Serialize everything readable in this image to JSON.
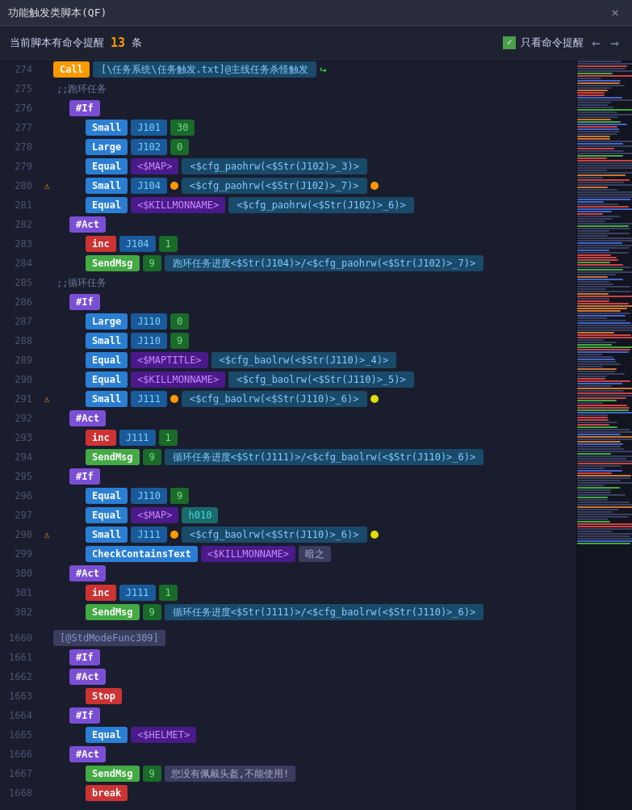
{
  "titleBar": {
    "title": "功能触发类脚本(QF)",
    "closeLabel": "×"
  },
  "toolbar": {
    "prefix": "当前脚本有命令提醒",
    "count": "13",
    "unit": "条",
    "checkboxLabel": "只看命令提醒",
    "checked": true
  },
  "lines": [
    {
      "num": "274",
      "warn": false,
      "indent": 0,
      "type": "call",
      "content": [
        {
          "tag": "call",
          "label": "Call"
        },
        {
          "type": "val-long",
          "text": "[\\任务系统\\任务触发.txt]@主线任务杀怪触发"
        },
        {
          "type": "redirect",
          "text": "↪"
        }
      ]
    },
    {
      "num": "275",
      "warn": false,
      "indent": 0,
      "type": "comment",
      "content": [
        {
          "type": "comment",
          "text": ";;跑环任务"
        }
      ]
    },
    {
      "num": "276",
      "warn": false,
      "indent": 1,
      "content": [
        {
          "tag": "if",
          "label": "#If"
        }
      ]
    },
    {
      "num": "277",
      "warn": false,
      "indent": 2,
      "content": [
        {
          "tag": "small",
          "label": "Small"
        },
        {
          "type": "val-blue",
          "text": "J101"
        },
        {
          "type": "val-green",
          "text": "30"
        }
      ]
    },
    {
      "num": "278",
      "warn": false,
      "indent": 2,
      "content": [
        {
          "tag": "large",
          "label": "Large"
        },
        {
          "type": "val-blue",
          "text": "J102"
        },
        {
          "type": "val-green",
          "text": "0"
        }
      ]
    },
    {
      "num": "279",
      "warn": false,
      "indent": 2,
      "content": [
        {
          "tag": "equal",
          "label": "Equal"
        },
        {
          "type": "val-purple",
          "text": "<$MAP>"
        },
        {
          "type": "val-long",
          "text": "<$cfg_paohrw(<$Str(J102)>_3)>"
        }
      ]
    },
    {
      "num": "280",
      "warn": true,
      "indent": 2,
      "content": [
        {
          "tag": "small",
          "label": "Small"
        },
        {
          "type": "val-blue",
          "text": "J104"
        },
        {
          "type": "dot-orange"
        },
        {
          "type": "val-long",
          "text": "<$cfg_paohrw(<$Str(J102)>_7)>"
        },
        {
          "type": "dot-orange"
        }
      ]
    },
    {
      "num": "281",
      "warn": false,
      "indent": 2,
      "content": [
        {
          "tag": "equal",
          "label": "Equal"
        },
        {
          "type": "val-purple",
          "text": "<$KILLMONNAME>"
        },
        {
          "type": "val-long",
          "text": "<$cfg_paohrw(<$Str(J102)>_6)>"
        }
      ]
    },
    {
      "num": "282",
      "warn": false,
      "indent": 1,
      "content": [
        {
          "tag": "act",
          "label": "#Act"
        }
      ]
    },
    {
      "num": "283",
      "warn": false,
      "indent": 2,
      "content": [
        {
          "tag": "inc",
          "label": "inc"
        },
        {
          "type": "val-blue",
          "text": "J104"
        },
        {
          "type": "val-green",
          "text": "1"
        }
      ]
    },
    {
      "num": "284",
      "warn": false,
      "indent": 2,
      "content": [
        {
          "tag": "sendmsg",
          "label": "SendMsg"
        },
        {
          "type": "val-green",
          "text": "9"
        },
        {
          "type": "val-long",
          "text": "跑环任务进度<$Str(J104)>/<$cfg_paohrw(<$Str(J102)>_7)>"
        }
      ]
    },
    {
      "num": "285",
      "warn": false,
      "indent": 0,
      "type": "comment",
      "content": [
        {
          "type": "comment",
          "text": ";;循环任务"
        }
      ]
    },
    {
      "num": "286",
      "warn": false,
      "indent": 1,
      "content": [
        {
          "tag": "if",
          "label": "#If"
        }
      ]
    },
    {
      "num": "287",
      "warn": false,
      "indent": 2,
      "content": [
        {
          "tag": "large",
          "label": "Large"
        },
        {
          "type": "val-blue",
          "text": "J110"
        },
        {
          "type": "val-green",
          "text": "0"
        }
      ]
    },
    {
      "num": "288",
      "warn": false,
      "indent": 2,
      "content": [
        {
          "tag": "small",
          "label": "Small"
        },
        {
          "type": "val-blue",
          "text": "J110"
        },
        {
          "type": "val-green",
          "text": "9"
        }
      ]
    },
    {
      "num": "289",
      "warn": false,
      "indent": 2,
      "content": [
        {
          "tag": "equal",
          "label": "Equal"
        },
        {
          "type": "val-purple",
          "text": "<$MAPTITLE>"
        },
        {
          "type": "val-long",
          "text": "<$cfg_baolrw(<$Str(J110)>_4)>"
        }
      ]
    },
    {
      "num": "290",
      "warn": false,
      "indent": 2,
      "content": [
        {
          "tag": "equal",
          "label": "Equal"
        },
        {
          "type": "val-purple",
          "text": "<$KILLMONNAME>"
        },
        {
          "type": "val-long",
          "text": "<$cfg_baolrw(<$Str(J110)>_5)>"
        }
      ]
    },
    {
      "num": "291",
      "warn": true,
      "indent": 2,
      "content": [
        {
          "tag": "small",
          "label": "Small"
        },
        {
          "type": "val-blue",
          "text": "J111"
        },
        {
          "type": "dot-orange"
        },
        {
          "type": "val-long",
          "text": "<$cfg_baolrw(<$Str(J110)>_6)>"
        },
        {
          "type": "dot-yellow"
        }
      ]
    },
    {
      "num": "292",
      "warn": false,
      "indent": 1,
      "content": [
        {
          "tag": "act",
          "label": "#Act"
        }
      ]
    },
    {
      "num": "293",
      "warn": false,
      "indent": 2,
      "content": [
        {
          "tag": "inc",
          "label": "inc"
        },
        {
          "type": "val-blue",
          "text": "J111"
        },
        {
          "type": "val-green",
          "text": "1"
        }
      ]
    },
    {
      "num": "294",
      "warn": false,
      "indent": 2,
      "content": [
        {
          "tag": "sendmsg",
          "label": "SendMsg"
        },
        {
          "type": "val-green",
          "text": "9"
        },
        {
          "type": "val-long",
          "text": "循环任务进度<$Str(J111)>/<$cfg_baolrw(<$Str(J110)>_6)>"
        }
      ]
    },
    {
      "num": "295",
      "warn": false,
      "indent": 1,
      "content": [
        {
          "tag": "if",
          "label": "#If"
        }
      ]
    },
    {
      "num": "296",
      "warn": false,
      "indent": 2,
      "content": [
        {
          "tag": "equal",
          "label": "Equal"
        },
        {
          "type": "val-blue",
          "text": "J110"
        },
        {
          "type": "val-green",
          "text": "9"
        }
      ]
    },
    {
      "num": "297",
      "warn": false,
      "indent": 2,
      "content": [
        {
          "tag": "equal",
          "label": "Equal"
        },
        {
          "type": "val-purple",
          "text": "<$MAP>"
        },
        {
          "type": "val-teal",
          "text": "h010"
        }
      ]
    },
    {
      "num": "298",
      "warn": true,
      "indent": 2,
      "content": [
        {
          "tag": "small",
          "label": "Small"
        },
        {
          "type": "val-blue",
          "text": "J111"
        },
        {
          "type": "dot-orange"
        },
        {
          "type": "val-long",
          "text": "<$cfg_baolrw(<$Str(J110)>_6)>"
        },
        {
          "type": "dot-yellow"
        }
      ]
    },
    {
      "num": "299",
      "warn": false,
      "indent": 2,
      "content": [
        {
          "tag": "check",
          "label": "CheckContainsText"
        },
        {
          "type": "val-purple",
          "text": "<$KILLMONNAME>"
        },
        {
          "type": "val-gray",
          "text": "暗之"
        }
      ]
    },
    {
      "num": "300",
      "warn": false,
      "indent": 1,
      "content": [
        {
          "tag": "act",
          "label": "#Act"
        }
      ]
    },
    {
      "num": "301",
      "warn": false,
      "indent": 2,
      "content": [
        {
          "tag": "inc",
          "label": "inc"
        },
        {
          "type": "val-blue",
          "text": "J111"
        },
        {
          "type": "val-green",
          "text": "1"
        }
      ]
    },
    {
      "num": "302",
      "warn": false,
      "indent": 2,
      "content": [
        {
          "tag": "sendmsg",
          "label": "SendMsg"
        },
        {
          "type": "val-green",
          "text": "9"
        },
        {
          "type": "val-long",
          "text": "循环任务进度<$Str(J111)>/<$cfg_baolrw(<$Str(J110)>_6)>"
        }
      ]
    },
    {
      "num": "1660",
      "warn": false,
      "indent": 0,
      "type": "stdmode",
      "content": [
        {
          "type": "stdmode",
          "text": "[@StdModeFunc309]"
        }
      ]
    },
    {
      "num": "1661",
      "warn": false,
      "indent": 1,
      "content": [
        {
          "tag": "if",
          "label": "#If"
        }
      ]
    },
    {
      "num": "1662",
      "warn": false,
      "indent": 1,
      "content": [
        {
          "tag": "act",
          "label": "#Act"
        }
      ]
    },
    {
      "num": "1663",
      "warn": false,
      "indent": 2,
      "content": [
        {
          "tag": "stop",
          "label": "Stop"
        }
      ]
    },
    {
      "num": "1664",
      "warn": false,
      "indent": 1,
      "content": [
        {
          "tag": "if",
          "label": "#If"
        }
      ]
    },
    {
      "num": "1665",
      "warn": false,
      "indent": 2,
      "content": [
        {
          "tag": "equal",
          "label": "Equal"
        },
        {
          "type": "val-purple",
          "text": "<$HELMET>"
        }
      ]
    },
    {
      "num": "1666",
      "warn": false,
      "indent": 1,
      "content": [
        {
          "tag": "act",
          "label": "#Act"
        }
      ]
    },
    {
      "num": "1667",
      "warn": false,
      "indent": 2,
      "content": [
        {
          "tag": "sendmsg",
          "label": "SendMsg"
        },
        {
          "type": "val-green",
          "text": "9"
        },
        {
          "type": "val-gray",
          "text": "您没有佩戴头盔,不能使用!"
        }
      ]
    },
    {
      "num": "1668",
      "warn": false,
      "indent": 2,
      "content": [
        {
          "tag": "break",
          "label": "break"
        }
      ]
    }
  ]
}
